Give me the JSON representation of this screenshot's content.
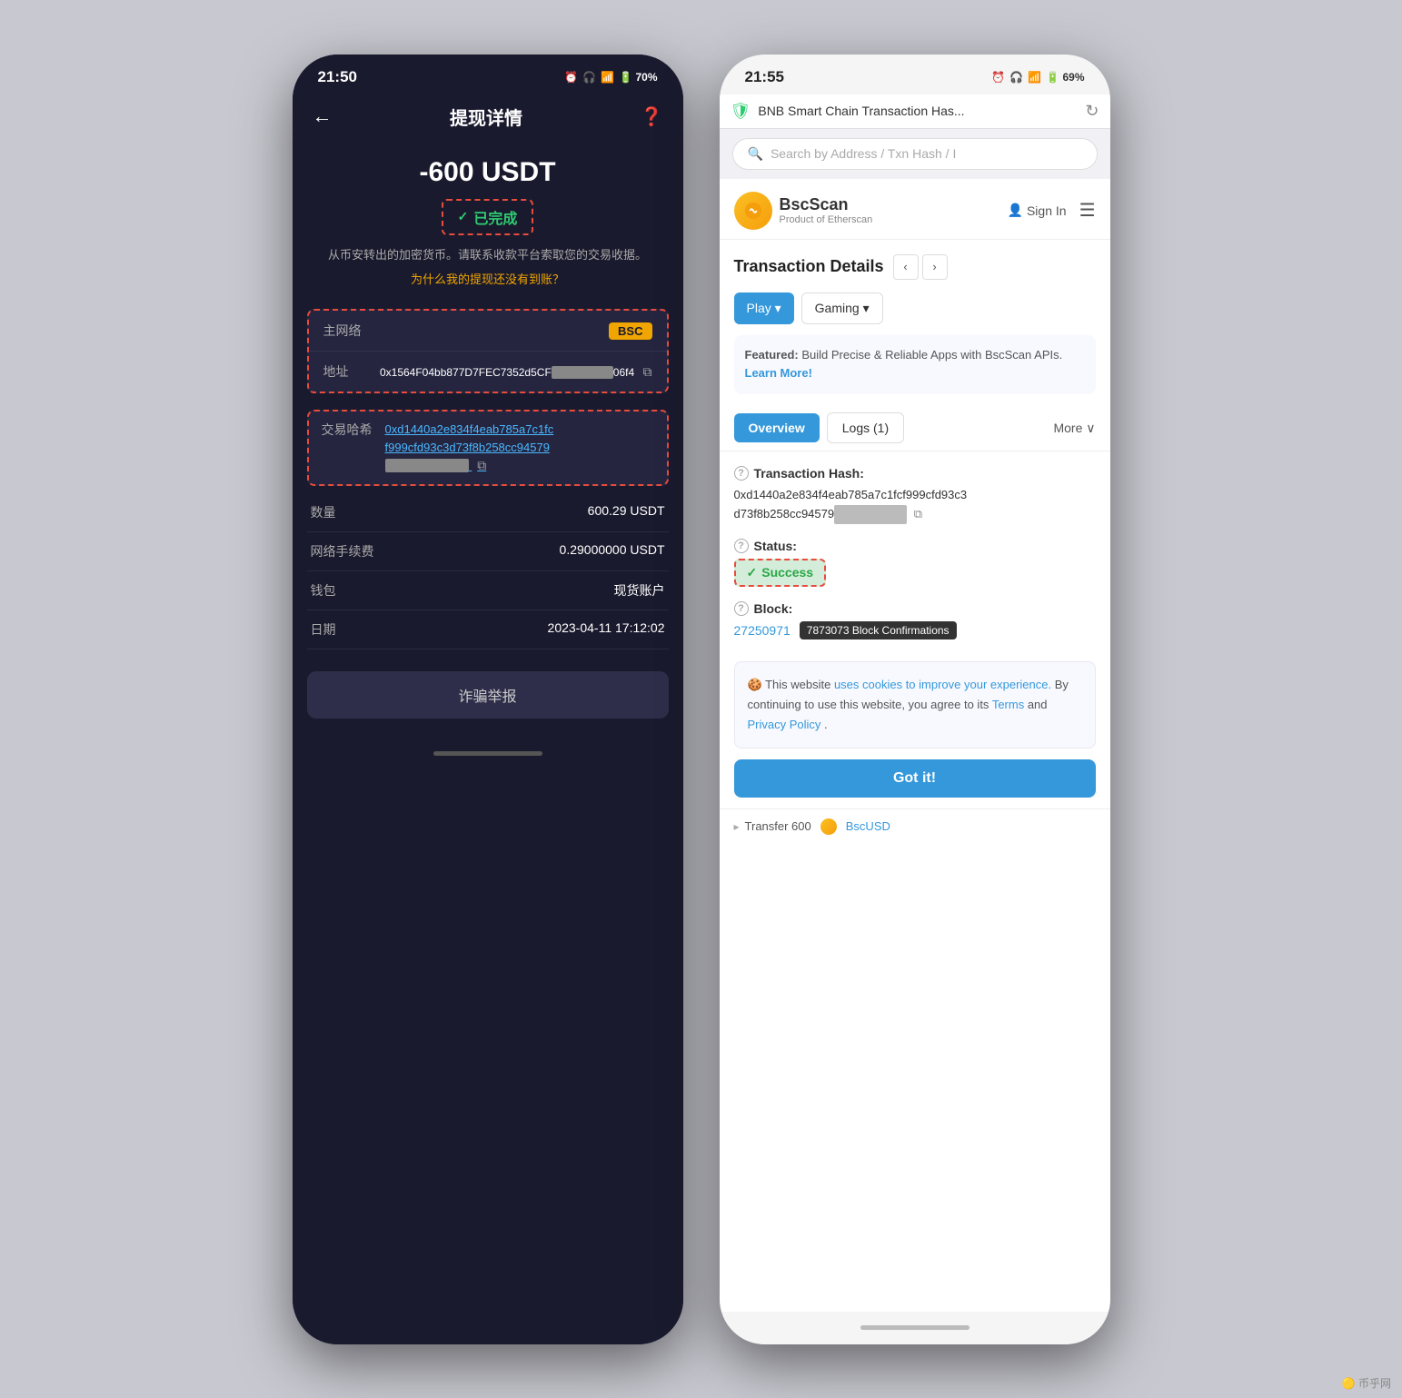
{
  "left_phone": {
    "status_bar": {
      "time": "21:50",
      "icons": "⏰ 🎧 📷 📶 📶 🔋 70%"
    },
    "header": {
      "back": "←",
      "title": "提现详情",
      "icon": "?"
    },
    "amount": "-600 USDT",
    "status": "已完成",
    "notice": "从币安转出的加密货币。请联系收款平台索取您的交易收据。",
    "link": "为什么我的提现还没有到账？",
    "network_section": {
      "label": "主网络",
      "value": "BSC"
    },
    "address_row": {
      "label": "地址",
      "value": "0x1564F04bb877D7FEC7352d5CF██████████06f4"
    },
    "hash_row": {
      "label": "交易哈希",
      "value": "0xd1440a2e834f4eab785a7c1fcf999cfd93c3d73f8b258cc94579██████████"
    },
    "rows": [
      {
        "label": "数量",
        "value": "600.29 USDT"
      },
      {
        "label": "网络手续费",
        "value": "0.29000000 USDT"
      },
      {
        "label": "钱包",
        "value": "现货账户"
      },
      {
        "label": "日期",
        "value": "2023-04-11 17:12:02"
      }
    ],
    "report_button": "诈骗举报"
  },
  "right_phone": {
    "status_bar": {
      "time": "21:55",
      "icons": "⏰ 🎧 📷 📶 📶 🔋 69%"
    },
    "browser": {
      "url": "BNB Smart Chain Transaction Has...",
      "refresh": "↻"
    },
    "search_placeholder": "Search by Address / Txn Hash / I",
    "bscscan": {
      "name": "BscScan",
      "sub": "Product of Etherscan"
    },
    "signin": "Sign In",
    "tx_heading": "Transaction Details",
    "btn_play": "Play ▾",
    "btn_gaming": "Gaming ▾",
    "featured_text": "Featured: Build Precise & Reliable Apps with BscScan APIs.",
    "featured_link": "Learn More!",
    "tabs": {
      "overview": "Overview",
      "logs": "Logs (1)",
      "more": "More ∨"
    },
    "tx_hash_label": "Transaction Hash:",
    "tx_hash_value": "0xd1440a2e834f4eab785a7c1fcf999cfd93c3d73f8b258cc94579",
    "tx_hash_blur": "██████████",
    "status_label": "Status:",
    "status_value": "✓ Success",
    "block_label": "Block:",
    "block_number": "27250971",
    "confirmations": "7873073 Block Confirmations",
    "cookie_text": "This website",
    "cookie_link1": "uses cookies to improve your experience.",
    "cookie_mid": " By continuing to use this website, you agree to its ",
    "cookie_terms": "Terms",
    "cookie_and": " and ",
    "cookie_privacy": "Privacy Policy",
    "cookie_end": ".",
    "got_it": "Got it!",
    "transfer_text": "▸ Transfer 600",
    "transfer_link": "BscUSD"
  }
}
